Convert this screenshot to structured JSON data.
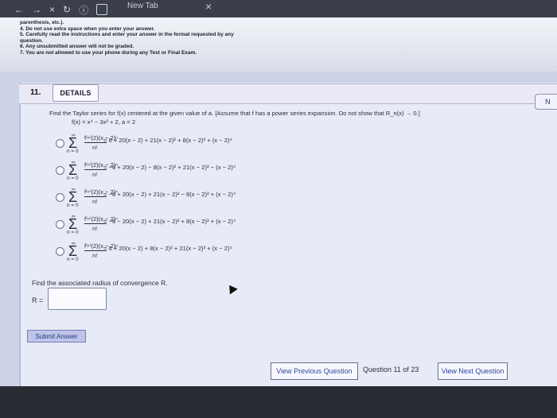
{
  "browser": {
    "tab_title": "New Tab",
    "tab_close": "×",
    "nav": {
      "back": "←",
      "forward": "→",
      "stop": "×",
      "reload": "↻",
      "info": "ⓘ"
    }
  },
  "instructions": {
    "lines": [
      "parenthesis, etc.).",
      "4.   Do not use extra space when you enter your answer.",
      "5.   Carefully read the instructions and enter your answer in the format requested by any",
      "question.",
      "6.   Any unsubmitted answer will not be graded.",
      "7.   You are not allowed to use your phone during any Test or Final Exam."
    ]
  },
  "question": {
    "number": "11.",
    "details_label": "DETAILS",
    "side_chip_label": "N",
    "prompt": "Find the Taylor series for f(x) centered at the given value of a. [Assume that f has a power series expansion. Do not show that R_n(x) → 0.]",
    "function_line": "f(x) = x⁴ − 3x² + 2,  a = 2",
    "options": [
      {
        "sum_top": "∞",
        "sum_sigma": "Σ",
        "sum_bottom": "n = 0",
        "frac_num": "f⁽ⁿ⁾(2)(x − 2)ⁿ",
        "frac_den": "n!",
        "expr": "= 6 + 20(x − 2) + 21(x − 2)² + 8(x − 2)³ + (x − 2)⁴"
      },
      {
        "sum_top": "∞",
        "sum_sigma": "Σ",
        "sum_bottom": "n = 0",
        "frac_num": "f⁽ⁿ⁾(2)(x − 2)ⁿ",
        "frac_den": "n!",
        "expr": "= −6 + 20(x − 2) − 8(x − 2)² + 21(x − 2)³ − (x − 2)⁴"
      },
      {
        "sum_top": "∞",
        "sum_sigma": "Σ",
        "sum_bottom": "n = 0",
        "frac_num": "f⁽ⁿ⁾(2)(x − 2)ⁿ",
        "frac_den": "n!",
        "expr": "= −6 + 20(x − 2) + 21(x − 2)² − 8(x − 2)³ + (x − 2)⁴"
      },
      {
        "sum_top": "∞",
        "sum_sigma": "Σ",
        "sum_bottom": "n = 0",
        "frac_num": "f⁽ⁿ⁾(2)(x − 2)ⁿ",
        "frac_den": "n!",
        "expr": "= −6 − 20(x − 2) + 21(x − 2)² + 8(x − 2)³ + (x − 2)⁴"
      },
      {
        "sum_top": "∞",
        "sum_sigma": "Σ",
        "sum_bottom": "n = 0",
        "frac_num": "f⁽ⁿ⁾(2)(x − 2)ⁿ",
        "frac_den": "n!",
        "expr": "= 6 + 20(x − 2) + 8(x − 2)² + 21(x − 2)³ + (x − 2)⁴"
      }
    ],
    "radius_prompt": "Find the associated radius of convergence R.",
    "radius_label": "R =",
    "radius_value": "",
    "submit_label": "Submit Answer"
  },
  "footer": {
    "prev_label": "View Previous Question",
    "position_label": "Question 11 of 23",
    "next_label": "View Next Question"
  }
}
